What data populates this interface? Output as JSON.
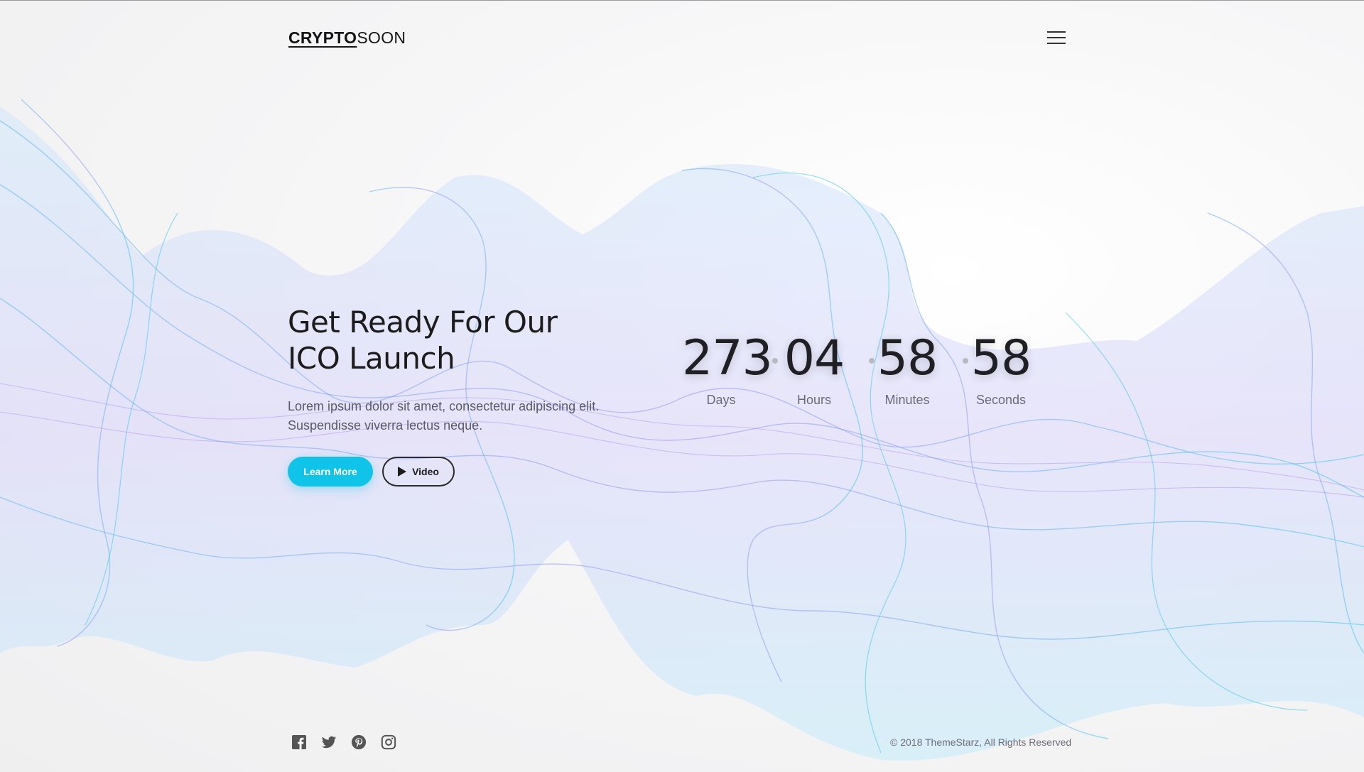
{
  "header": {
    "logo_bold": "CRYPTO",
    "logo_light": "SOON",
    "menu_icon": "hamburger-menu-icon"
  },
  "hero": {
    "title_line1": "Get Ready For Our",
    "title_line2": "ICO Launch",
    "desc_line1": "Lorem ipsum dolor sit amet, consectetur adipiscing elit.",
    "desc_line2": "Suspendisse viverra lectus neque.",
    "learn_more_label": "Learn More",
    "video_label": "Video",
    "video_icon": "play-icon"
  },
  "countdown": {
    "days": "273",
    "days_label": "Days",
    "hours": "04",
    "hours_label": "Hours",
    "minutes": "58",
    "minutes_label": "Minutes",
    "seconds": "58",
    "seconds_label": "Seconds"
  },
  "footer": {
    "social_icons": [
      "facebook-icon",
      "twitter-icon",
      "pinterest-icon",
      "instagram-icon"
    ],
    "copyright": "© 2018 ThemeStarz, All Rights Reserved"
  },
  "colors": {
    "accent": "#10c3e8",
    "wave_cyan": "#3fc8f0",
    "wave_violet": "#a78bf0",
    "text_dark": "#1c1c1c",
    "text_muted": "#5a5a66"
  }
}
